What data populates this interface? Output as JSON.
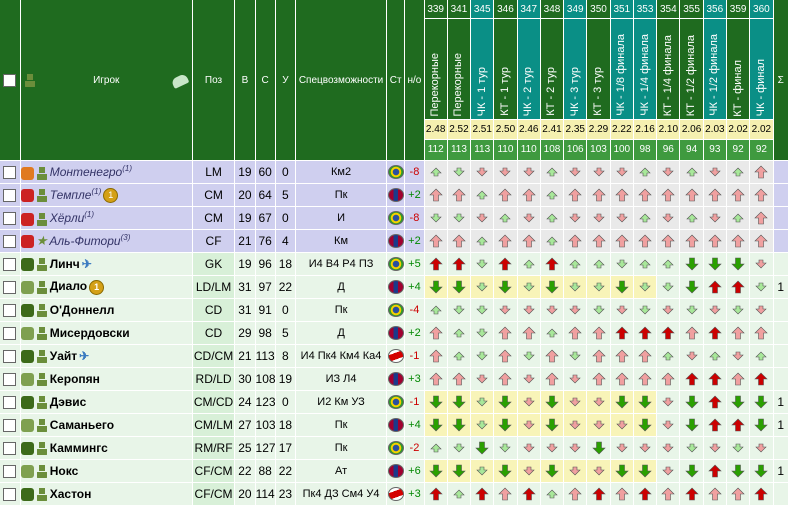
{
  "header": {
    "player_col": "Игрок",
    "pos_col": "Поз",
    "age_col": "В",
    "skill_col": "С",
    "fit_col": "У",
    "special_col": "Спецвозможности",
    "country_col": "Ст",
    "form_col": "н/о",
    "sum_col": "Σ"
  },
  "matches": [
    {
      "num": "339",
      "label": "Перекорные",
      "gd": "2.48",
      "fit": "112",
      "cup": false
    },
    {
      "num": "341",
      "label": "Перекорные",
      "gd": "2.52",
      "fit": "113",
      "cup": false
    },
    {
      "num": "345",
      "label": "ЧК - 1 тур",
      "gd": "2.51",
      "fit": "113",
      "cup": true
    },
    {
      "num": "346",
      "label": "КТ - 1 тур",
      "gd": "2.50",
      "fit": "110",
      "cup": false
    },
    {
      "num": "347",
      "label": "ЧК - 2 тур",
      "gd": "2.46",
      "fit": "110",
      "cup": true
    },
    {
      "num": "348",
      "label": "КТ - 2 тур",
      "gd": "2.41",
      "fit": "108",
      "cup": false
    },
    {
      "num": "349",
      "label": "ЧК - 3 тур",
      "gd": "2.35",
      "fit": "106",
      "cup": true
    },
    {
      "num": "350",
      "label": "КТ - 3 тур",
      "gd": "2.29",
      "fit": "103",
      "cup": false
    },
    {
      "num": "351",
      "label": "ЧК - 1/8 финала",
      "gd": "2.22",
      "fit": "100",
      "cup": true
    },
    {
      "num": "353",
      "label": "ЧК - 1/4 финала",
      "gd": "2.16",
      "fit": "98",
      "cup": true
    },
    {
      "num": "354",
      "label": "КТ - 1/4 финала",
      "gd": "2.10",
      "fit": "96",
      "cup": false
    },
    {
      "num": "355",
      "label": "КТ - 1/2 финала",
      "gd": "2.06",
      "fit": "94",
      "cup": false
    },
    {
      "num": "356",
      "label": "ЧК - 1/2 финала",
      "gd": "2.03",
      "fit": "93",
      "cup": true
    },
    {
      "num": "359",
      "label": "КТ - финал",
      "gd": "2.02",
      "fit": "92",
      "cup": false
    },
    {
      "num": "360",
      "label": "ЧК - финал",
      "gd": "2.02",
      "fit": "92",
      "cup": true
    }
  ],
  "players": [
    {
      "name": "Монтенегро",
      "sup": "(1)",
      "medal": "",
      "plane": false,
      "kind": "transfer",
      "pos": "LM",
      "age": "19",
      "skill": "60",
      "fit": "0",
      "spec": "Км2",
      "flag": "brazil",
      "form": "-8",
      "sum": "",
      "arrows": [
        "ul",
        "dl",
        "d",
        "d",
        "d",
        "ul",
        "d",
        "d",
        "d",
        "ul",
        "d",
        "ul",
        "d",
        "ul",
        "u"
      ]
    },
    {
      "name": "Темпле",
      "sup": "(1)",
      "medal": "1",
      "plane": false,
      "kind": "transfer",
      "pos": "CM",
      "age": "20",
      "skill": "64",
      "fit": "5",
      "spec": "Пк",
      "flag": "barca",
      "form": "+2",
      "sum": "",
      "arrows": [
        "u",
        "u",
        "ul",
        "u",
        "u",
        "ul",
        "u",
        "u",
        "u",
        "u",
        "u",
        "u",
        "u",
        "u",
        "u"
      ]
    },
    {
      "name": "Хёрли",
      "sup": "(1)",
      "medal": "",
      "plane": false,
      "kind": "transfer",
      "pos": "CM",
      "age": "19",
      "skill": "67",
      "fit": "0",
      "spec": "И",
      "flag": "brazil",
      "form": "-8",
      "sum": "",
      "arrows": [
        "dl",
        "dl",
        "d",
        "ul",
        "d",
        "ul",
        "d",
        "d",
        "d",
        "ul",
        "d",
        "ul",
        "d",
        "ul",
        "u"
      ]
    },
    {
      "name": "Аль-Фитори",
      "sup": "(3)",
      "medal": "",
      "plane": false,
      "kind": "transfer",
      "pos": "CF",
      "age": "21",
      "skill": "76",
      "fit": "4",
      "spec": "Км",
      "flag": "barca",
      "form": "+2",
      "sum": "",
      "arrows": [
        "u",
        "u",
        "ul",
        "u",
        "u",
        "ul",
        "u",
        "u",
        "u",
        "u",
        "u",
        "u",
        "u",
        "u",
        "u"
      ]
    },
    {
      "name": "Линч",
      "sup": "",
      "medal": "",
      "plane": true,
      "kind": "team",
      "pos": "GK",
      "age": "19",
      "skill": "96",
      "fit": "18",
      "spec": "И4 В4 Р4 ПЗ",
      "flag": "brazil",
      "form": "+5",
      "sum": "",
      "arrows": [
        "U",
        "U",
        "dl",
        "U",
        "ul",
        "U",
        "ul",
        "ul",
        "dl",
        "ul",
        "ul",
        "D",
        "D",
        "D",
        "d"
      ]
    },
    {
      "name": "Диало",
      "sup": "",
      "medal": "1",
      "plane": false,
      "kind": "team",
      "pos": "LD/LM",
      "age": "31",
      "skill": "97",
      "fit": "22",
      "spec": "Д",
      "flag": "barca",
      "form": "+4",
      "sum": "1",
      "arrows": [
        "D",
        "D",
        "dl",
        "D",
        "dl",
        "D",
        "dl",
        "dl",
        "D",
        "dl",
        "dl",
        "D",
        "U",
        "U",
        "dl"
      ]
    },
    {
      "name": "О'Доннелл",
      "sup": "",
      "medal": "",
      "plane": false,
      "kind": "team",
      "pos": "CD",
      "age": "31",
      "skill": "91",
      "fit": "0",
      "spec": "Пк",
      "flag": "brazil",
      "form": "-4",
      "sum": "",
      "arrows": [
        "ul",
        "dl",
        "dl",
        "d",
        "d",
        "d",
        "d",
        "dl",
        "d",
        "dl",
        "d",
        "dl",
        "d",
        "dl",
        "d"
      ]
    },
    {
      "name": "Мисердовски",
      "sup": "",
      "medal": "",
      "plane": false,
      "kind": "team",
      "pos": "CD",
      "age": "29",
      "skill": "98",
      "fit": "5",
      "spec": "Д",
      "flag": "barca",
      "form": "+2",
      "sum": "",
      "arrows": [
        "u",
        "ul",
        "dl",
        "u",
        "u",
        "ul",
        "u",
        "u",
        "U",
        "U",
        "U",
        "u",
        "U",
        "u",
        "u"
      ]
    },
    {
      "name": "Уайт",
      "sup": "",
      "medal": "",
      "plane": true,
      "kind": "team",
      "pos": "CD/CM",
      "age": "21",
      "skill": "113",
      "fit": "8",
      "spec": "И4 Пк4 Км4 Ка4",
      "flag": "spartak",
      "form": "-1",
      "sum": "",
      "arrows": [
        "u",
        "ul",
        "dl",
        "u",
        "dl",
        "u",
        "dl",
        "u",
        "u",
        "u",
        "ul",
        "d",
        "ul",
        "d",
        "ul"
      ]
    },
    {
      "name": "Керопян",
      "sup": "",
      "medal": "",
      "plane": false,
      "kind": "team",
      "pos": "RD/LD",
      "age": "30",
      "skill": "108",
      "fit": "19",
      "spec": "ИЗ Л4",
      "flag": "barca",
      "form": "+3",
      "sum": "",
      "arrows": [
        "u",
        "u",
        "d",
        "u",
        "d",
        "u",
        "d",
        "u",
        "u",
        "u",
        "u",
        "U",
        "U",
        "u",
        "U"
      ]
    },
    {
      "name": "Дэвис",
      "sup": "",
      "medal": "",
      "plane": false,
      "kind": "team",
      "pos": "CM/CD",
      "age": "24",
      "skill": "123",
      "fit": "0",
      "spec": "И2 Км УЗ",
      "flag": "brazil",
      "form": "-1",
      "sum": "1",
      "arrows": [
        "D",
        "D",
        "dl",
        "D",
        "d",
        "D",
        "d",
        "d",
        "D",
        "D",
        "d",
        "D",
        "U",
        "D",
        "D"
      ]
    },
    {
      "name": "Саманьего",
      "sup": "",
      "medal": "",
      "plane": false,
      "kind": "team",
      "pos": "CM/LM",
      "age": "27",
      "skill": "103",
      "fit": "18",
      "spec": "Пк",
      "flag": "barca",
      "form": "+4",
      "sum": "1",
      "arrows": [
        "D",
        "D",
        "dl",
        "D",
        "d",
        "D",
        "d",
        "d",
        "d",
        "D",
        "d",
        "D",
        "U",
        "U",
        "D"
      ]
    },
    {
      "name": "Каммингс",
      "sup": "",
      "medal": "",
      "plane": false,
      "kind": "team",
      "pos": "RM/RF",
      "age": "25",
      "skill": "127",
      "fit": "17",
      "spec": "Пк",
      "flag": "brazil",
      "form": "-2",
      "sum": "",
      "arrows": [
        "ul",
        "dl",
        "D",
        "dl",
        "d",
        "d",
        "d",
        "D",
        "d",
        "d",
        "d",
        "dl",
        "d",
        "dl",
        "d"
      ]
    },
    {
      "name": "Нокс",
      "sup": "",
      "medal": "",
      "plane": false,
      "kind": "team",
      "pos": "CF/CM",
      "age": "22",
      "skill": "88",
      "fit": "22",
      "spec": "Ат",
      "flag": "barca",
      "form": "+6",
      "sum": "1",
      "arrows": [
        "D",
        "D",
        "dl",
        "D",
        "d",
        "D",
        "d",
        "d",
        "D",
        "D",
        "d",
        "D",
        "U",
        "D",
        "D"
      ]
    },
    {
      "name": "Хастон",
      "sup": "",
      "medal": "",
      "plane": false,
      "kind": "team",
      "pos": "CF/CM",
      "age": "20",
      "skill": "114",
      "fit": "23",
      "spec": "Пк4 ДЗ См4 У4",
      "flag": "spartak",
      "form": "+3",
      "sum": "",
      "arrows": [
        "U",
        "ul",
        "U",
        "u",
        "U",
        "ul",
        "u",
        "U",
        "u",
        "U",
        "u",
        "U",
        "u",
        "u",
        "U"
      ]
    }
  ],
  "colors": {
    "header_green": "#1f6b1f",
    "cup_teal": "#0a8f86",
    "transfer_row": "#cfcfef",
    "team_row": "#e8f5e8",
    "arrow_up_red": "#cc0000",
    "arrow_down_green": "#2aa000",
    "arrow_light_red": "#f0a0a0",
    "arrow_light_green": "#a8e89a"
  }
}
